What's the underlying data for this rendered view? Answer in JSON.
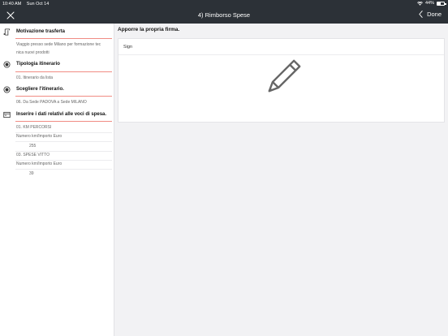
{
  "status_bar": {
    "time": "10:40 AM",
    "date": "Sun Oct 14",
    "battery": "44%",
    "battery_level": 0.44
  },
  "nav": {
    "title": "4) Rimborso Spese",
    "done_label": "Done",
    "icons": {
      "close": "close-icon",
      "back": "chevron-left-icon"
    }
  },
  "sidebar": {
    "sections": [
      {
        "icon": "document-icon",
        "title": "Motivazione trasferta",
        "lines": [
          "Viaggio presso sede Milano per formazione tec",
          "nica nuovi prodotti"
        ]
      },
      {
        "icon": "radio-icon",
        "title": "Tipologia itinerario",
        "lines": [
          "01. Itinerario da lista"
        ]
      },
      {
        "icon": "radio-icon",
        "title": "Scegliere l'itinerario.",
        "lines": [
          "06. Da Sede PADOVA a Sede MILANO"
        ]
      },
      {
        "icon": "receipt-icon",
        "title": "Inserire i dati relativi alle voci di spesa.",
        "items": [
          {
            "label": "01. KM PERCORSI",
            "field": "Numero km/Importo Euro",
            "value": "255"
          },
          {
            "label": "03. SPESE VITTO",
            "field": "Numero km/Importo Euro",
            "value": "39"
          }
        ]
      }
    ]
  },
  "main": {
    "title": "Apporre la propria firma.",
    "sign_label": "Sign",
    "sign_icon": "pencil-icon"
  }
}
